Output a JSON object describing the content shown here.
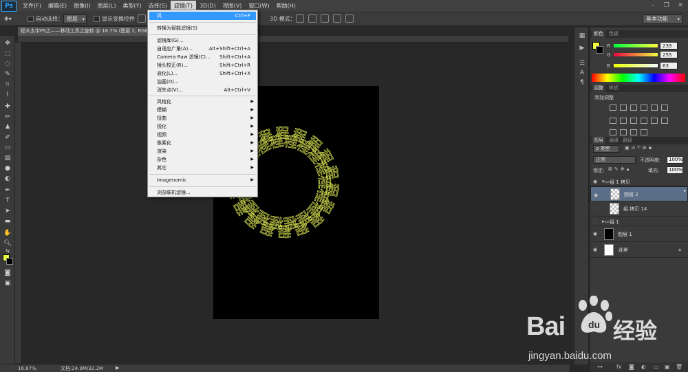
{
  "menubar": {
    "logo": "Ps",
    "items": [
      "文件(F)",
      "编辑(E)",
      "图像(I)",
      "图层(L)",
      "类型(Y)",
      "选择(S)",
      "滤镜(T)",
      "3D(D)",
      "视图(V)",
      "窗口(W)",
      "帮助(H)"
    ],
    "active_index": 6
  },
  "options_bar": {
    "auto_select_label": "自动选择：",
    "auto_select_value": "图层",
    "show_transform_label": "显示变换控件",
    "mode_3d_label": "3D 模式：",
    "workspace": "基本功能"
  },
  "doc_tab": {
    "title": "程木太宇PS之——移动工具之旋转 @ 16.7% (图层 2, RGB/8)"
  },
  "status": {
    "zoom": "16.67%",
    "doc_size": "文档:24.9M/32.2M"
  },
  "filter_menu": {
    "items": [
      {
        "label": "风",
        "shortcut": "Ctrl+F",
        "highlight": true
      },
      {
        "label": "转换为智能滤镜(S)",
        "shortcut": ""
      },
      {
        "label": "滤镜库(G)...",
        "shortcut": ""
      },
      {
        "label": "自适应广角(A)...",
        "shortcut": "Alt+Shift+Ctrl+A"
      },
      {
        "label": "Camera Raw 滤镜(C)...",
        "shortcut": "Shift+Ctrl+A"
      },
      {
        "label": "镜头校正(R)...",
        "shortcut": "Shift+Ctrl+R"
      },
      {
        "label": "液化(L)...",
        "shortcut": "Shift+Ctrl+X"
      },
      {
        "label": "油画(O)...",
        "shortcut": ""
      },
      {
        "label": "消失点(V)...",
        "shortcut": "Alt+Ctrl+V"
      },
      {
        "label": "风格化",
        "submenu": true
      },
      {
        "label": "模糊",
        "submenu": true
      },
      {
        "label": "扭曲",
        "submenu": true
      },
      {
        "label": "锐化",
        "submenu": true
      },
      {
        "label": "视频",
        "submenu": true
      },
      {
        "label": "像素化",
        "submenu": true
      },
      {
        "label": "渲染",
        "submenu": true
      },
      {
        "label": "杂色",
        "submenu": true
      },
      {
        "label": "其它",
        "submenu": true
      },
      {
        "label": "Imagenomic",
        "submenu": true
      },
      {
        "label": "浏览联机滤镜...",
        "shortcut": ""
      }
    ]
  },
  "color_panel": {
    "tabs": [
      "颜色",
      "色板"
    ],
    "r_label": "R",
    "r_value": "239",
    "g_label": "G",
    "g_value": "255",
    "b_label": "B",
    "b_value": "63",
    "foreground": "#efff3f"
  },
  "adjust_panel": {
    "tabs": [
      "调整",
      "样式"
    ],
    "heading": "添加调整"
  },
  "layers_panel": {
    "tabs": [
      "图层",
      "通道",
      "路径"
    ],
    "filter_label": "ρ 类型",
    "blend_mode": "正常",
    "opacity_label": "不透明度:",
    "opacity_value": "100%",
    "lock_label": "锁定:",
    "fill_label": "填充:",
    "fill_value": "100%",
    "layers": [
      {
        "name": "组 1 拷贝",
        "type": "folder",
        "visible": true
      },
      {
        "name": "图层 2",
        "type": "layer",
        "visible": true,
        "selected": true
      },
      {
        "name": "组 拷贝 14",
        "type": "layer",
        "visible": false
      },
      {
        "name": "组 1",
        "type": "folder",
        "visible": false
      },
      {
        "name": "图层 1",
        "type": "layer",
        "visible": true
      },
      {
        "name": "背景",
        "type": "background",
        "visible": true
      }
    ]
  },
  "watermark": {
    "brand": "Bai",
    "brand_cn": "经验",
    "url": "jingyan.baidu.com"
  },
  "artwork": {
    "glyph": "程",
    "color": "#c6d14a"
  }
}
